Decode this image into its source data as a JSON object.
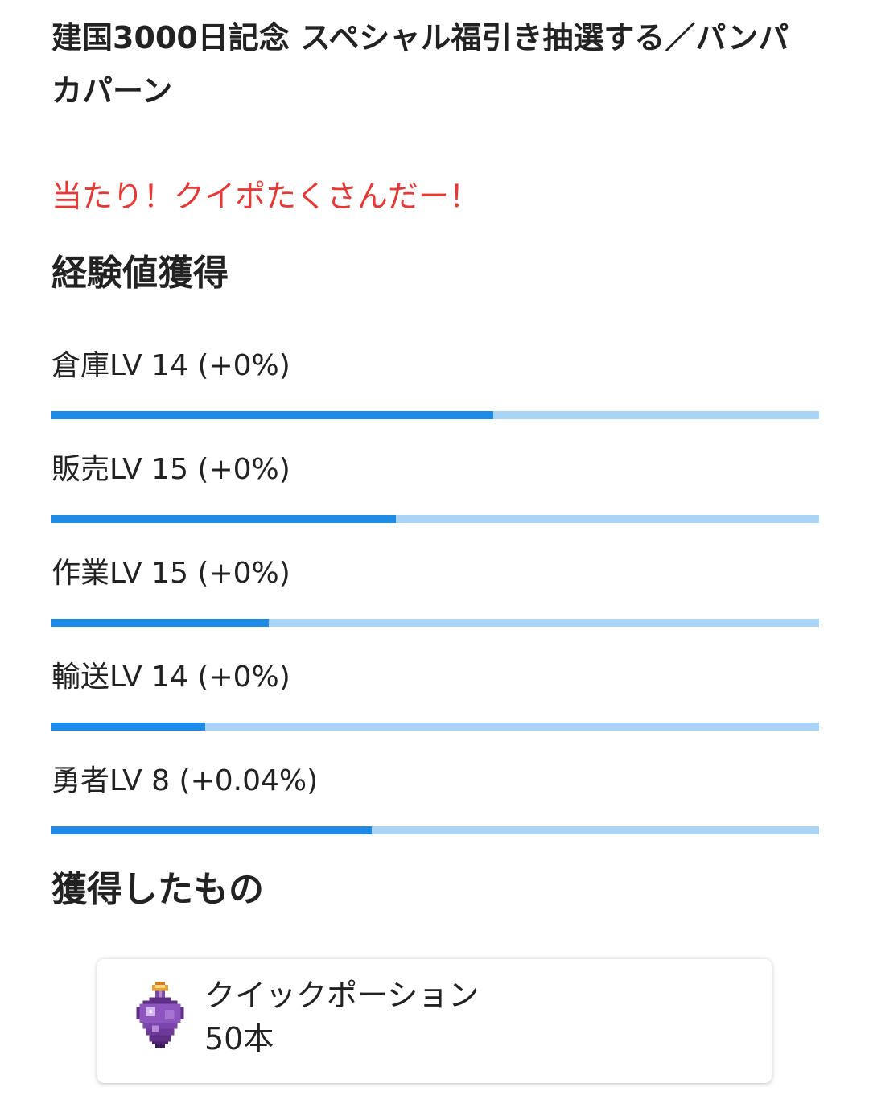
{
  "event": {
    "title": "建国3000日記念 スペシャル福引き抽選する／パンパカパーン"
  },
  "result": {
    "message": "当たり！クイポたくさんだー！",
    "message_color": "#e53935"
  },
  "experience": {
    "heading": "経験値獲得",
    "bar_color": "#1e8ce6",
    "track_color": "#a9d4f5",
    "levels": [
      {
        "label": "倉庫LV 14 (+0%)",
        "progress": 0.575
      },
      {
        "label": "販売LV 15 (+0%)",
        "progress": 0.449
      },
      {
        "label": "作業LV 15 (+0%)",
        "progress": 0.283
      },
      {
        "label": "輸送LV 14 (+0%)",
        "progress": 0.2
      },
      {
        "label": "勇者LV 8 (+0.04%)",
        "progress": 0.417
      }
    ]
  },
  "rewards": {
    "heading": "獲得したもの",
    "items": [
      {
        "name": "クイックポーション",
        "quantity": "50本",
        "icon": "purple-potion-icon"
      }
    ]
  }
}
